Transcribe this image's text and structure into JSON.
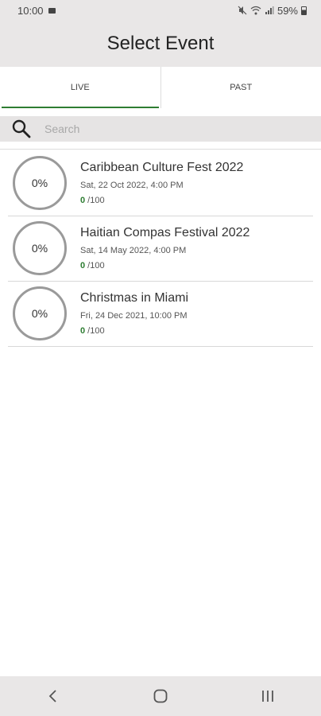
{
  "status_bar": {
    "time": "10:00",
    "battery": "59%"
  },
  "app_bar": {
    "title": "Select Event"
  },
  "tabs": [
    {
      "label": "LIVE",
      "active": true
    },
    {
      "label": "PAST",
      "active": false
    }
  ],
  "search": {
    "placeholder": "Search",
    "value": ""
  },
  "events": [
    {
      "progress": "0%",
      "name": "Caribbean Culture Fest 2022",
      "date": "Sat, 22 Oct 2022, 4:00 PM",
      "count": "0",
      "total": " /100"
    },
    {
      "progress": "0%",
      "name": "Haitian Compas Festival 2022",
      "date": "Sat, 14 May 2022, 4:00 PM",
      "count": "0",
      "total": " /100"
    },
    {
      "progress": "0%",
      "name": "Christmas in Miami",
      "date": "Fri, 24 Dec 2021, 10:00 PM",
      "count": "0",
      "total": " /100"
    }
  ],
  "nav_icons": [
    "back-icon",
    "home-icon",
    "recents-icon"
  ],
  "colors": {
    "accent": "#2e7d32",
    "bar_bg": "#e9e7e7"
  }
}
